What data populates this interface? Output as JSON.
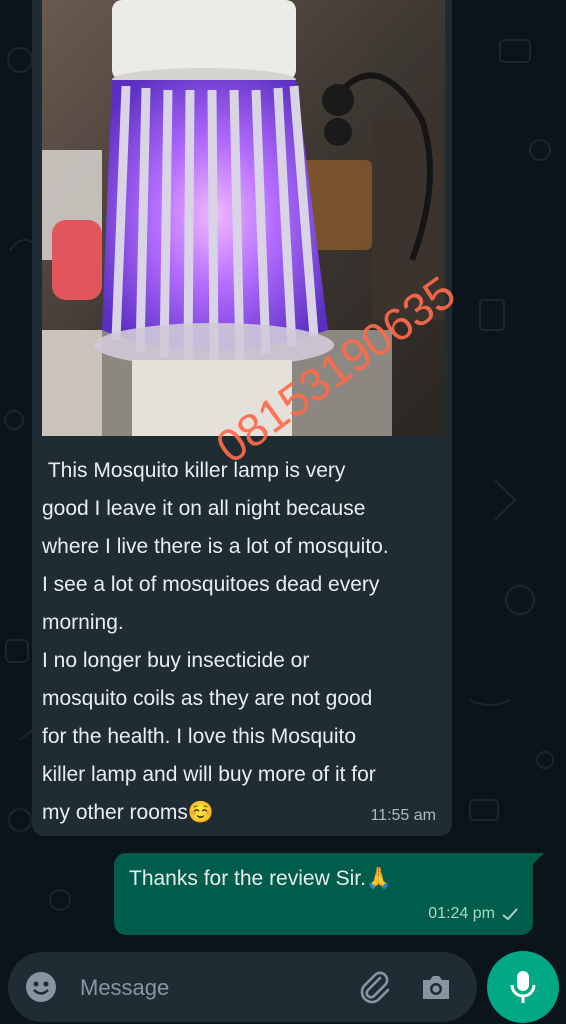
{
  "incoming_message": {
    "photo_watermark": "08153190635",
    "text": " This Mosquito killer lamp is very\ngood I leave it on all night because\nwhere I live there is a lot of mosquito.\nI see a lot of mosquitoes dead every\nmorning.\nI no longer buy insecticide or\nmosquito coils as they are not good\nfor the health. I love this Mosquito\nkiller lamp and will buy more of it for\nmy other rooms☺️",
    "time": "11:55 am"
  },
  "outgoing_message": {
    "text": "Thanks for the review Sir.🙏",
    "time": "01:24 pm",
    "status_icon": "single-check-icon"
  },
  "input_bar": {
    "placeholder": "Message",
    "icons": [
      "emoji-icon",
      "paperclip-icon",
      "camera-icon",
      "microphone-icon"
    ]
  },
  "colors": {
    "background": "#0b141a",
    "incoming_bubble": "#202c33",
    "outgoing_bubble": "#005c4b",
    "accent": "#00a884",
    "watermark": "#ff6a4a"
  }
}
